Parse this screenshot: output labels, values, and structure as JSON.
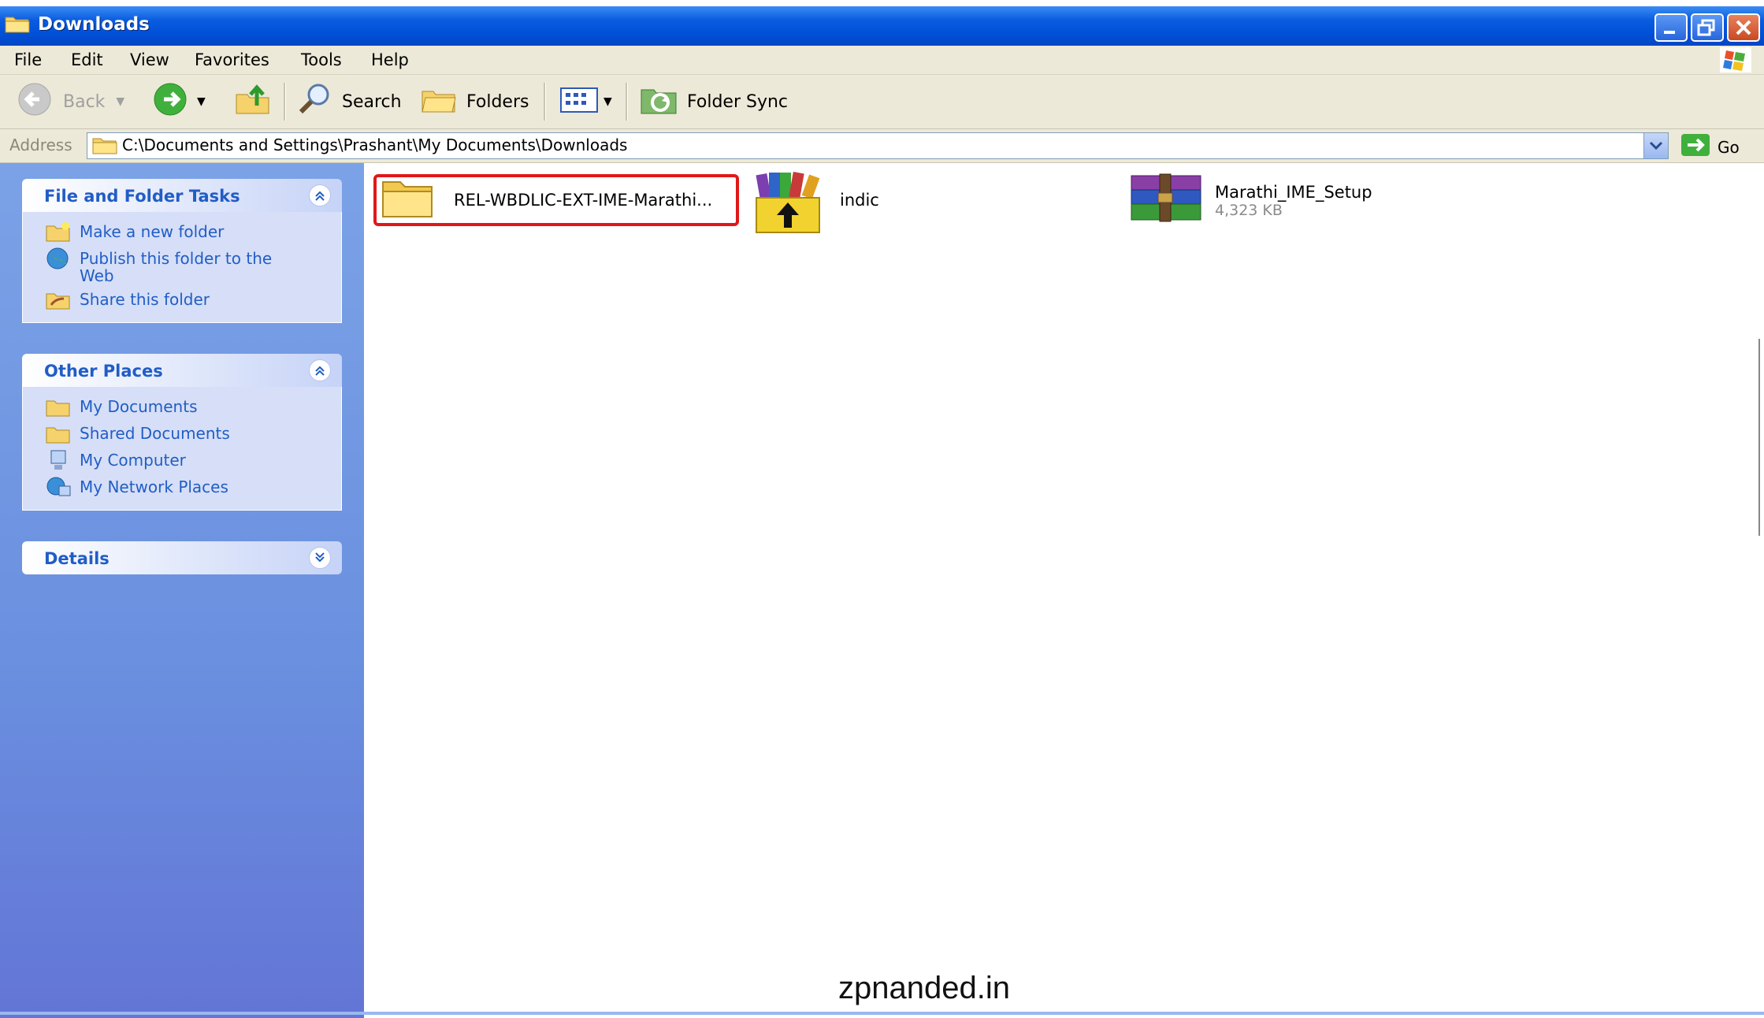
{
  "window": {
    "title": "Downloads"
  },
  "menu": {
    "items": [
      "File",
      "Edit",
      "View",
      "Favorites",
      "Tools",
      "Help"
    ]
  },
  "toolbar": {
    "back_label": "Back",
    "search_label": "Search",
    "folders_label": "Folders",
    "folder_sync_label": "Folder Sync"
  },
  "address": {
    "label": "Address",
    "path": "C:\\Documents and Settings\\Prashant\\My Documents\\Downloads",
    "go_label": "Go"
  },
  "tasks": {
    "file_folder": {
      "title": "File and Folder Tasks",
      "items": [
        "Make a new folder",
        "Publish this folder to the Web",
        "Share this folder"
      ]
    },
    "other_places": {
      "title": "Other Places",
      "items": [
        "My Documents",
        "Shared Documents",
        "My Computer",
        "My Network Places"
      ]
    },
    "details": {
      "title": "Details"
    }
  },
  "files": [
    {
      "name": "REL-WBDLIC-EXT-IME-Marathi...",
      "icon": "folder-icon",
      "highlighted": true
    },
    {
      "name": "indic",
      "icon": "installer-package-icon"
    },
    {
      "name": "Marathi_IME_Setup",
      "size": "4,323 KB",
      "icon": "winrar-archive-icon"
    }
  ],
  "watermark": "zpnanded.in",
  "colors": {
    "titlebar": "#0050d8",
    "taskpane": "#6a8fdf",
    "link": "#215dc6",
    "highlight": "#e01818"
  }
}
